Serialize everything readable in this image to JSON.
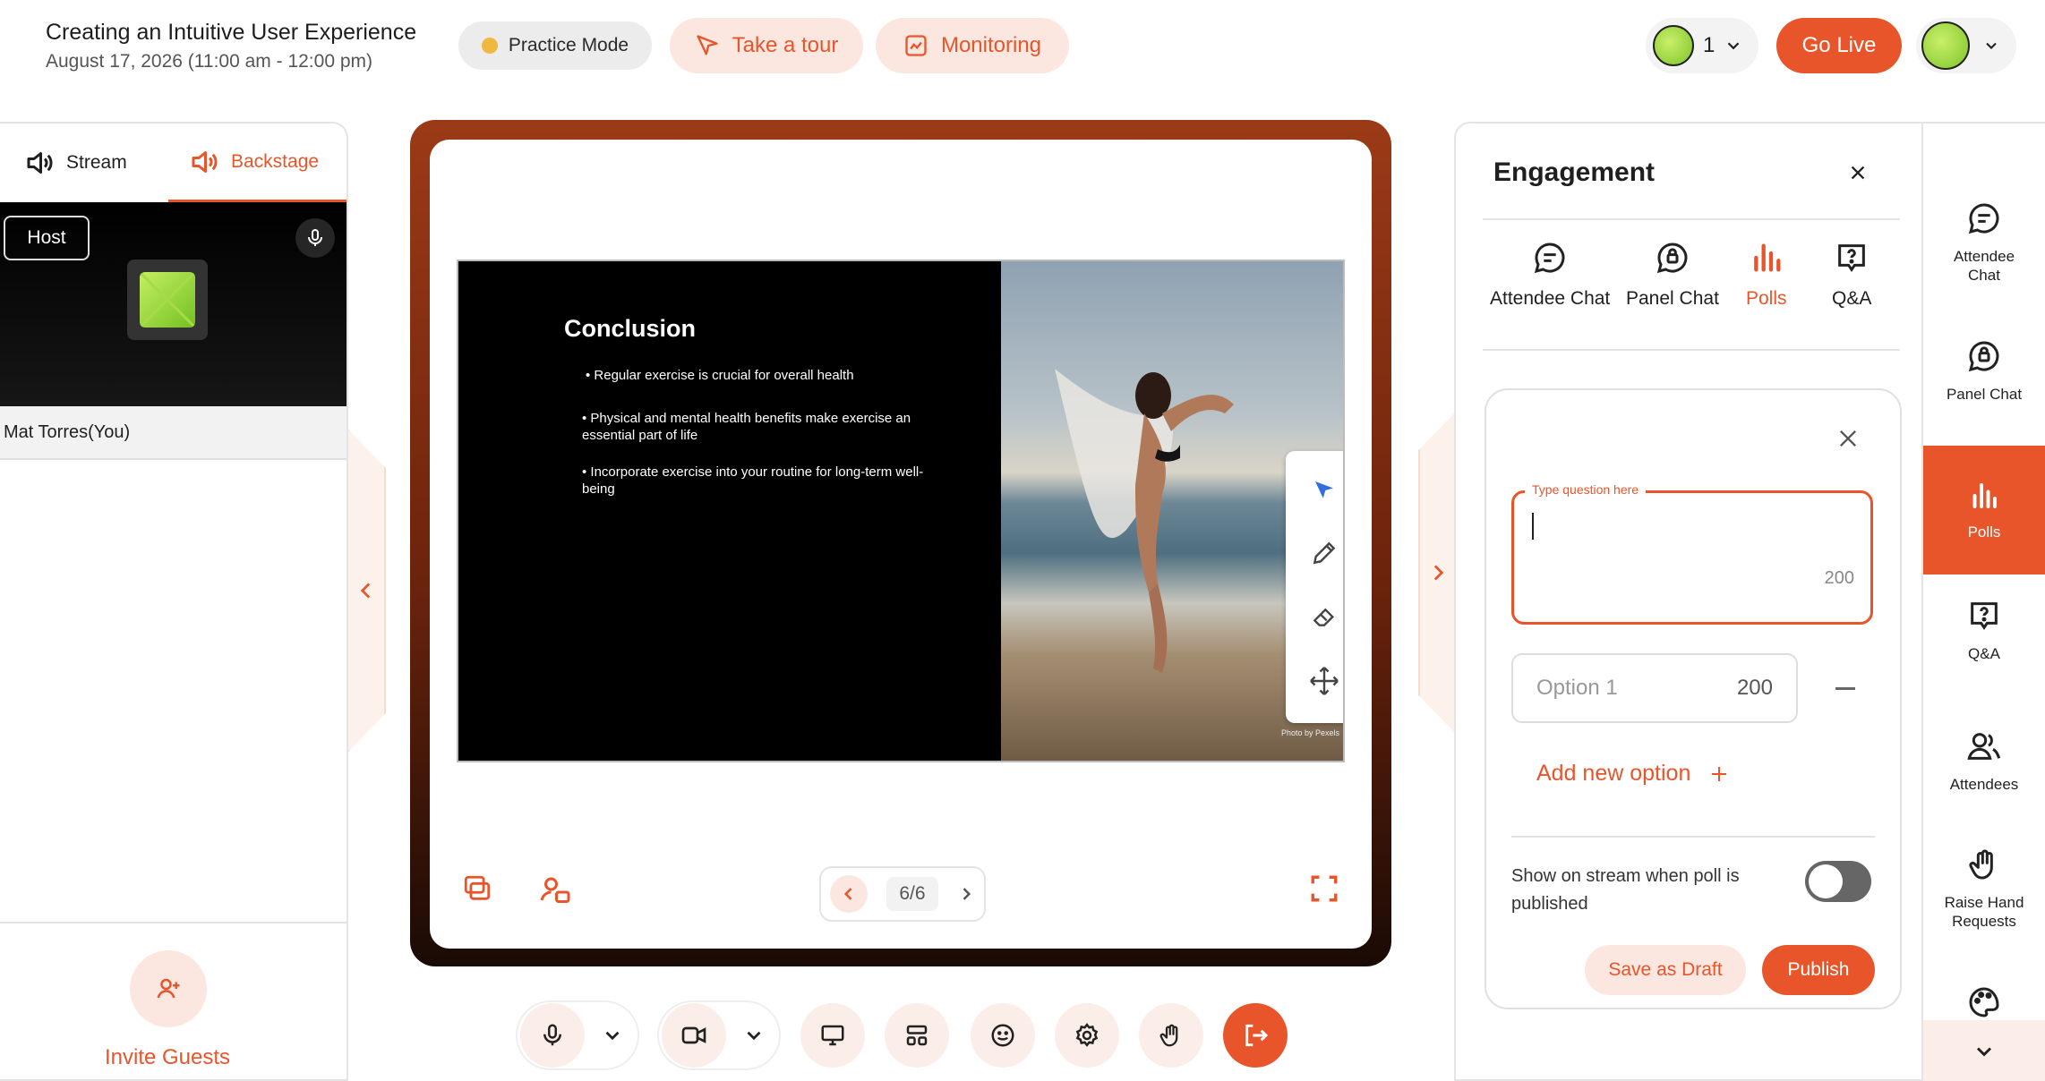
{
  "header": {
    "title": "Creating an Intuitive User Experience",
    "date": "August 17, 2026 (11:00 am - 12:00 pm)",
    "practice_mode": "Practice Mode",
    "take_tour": "Take a tour",
    "monitoring": "Monitoring",
    "attendee_count": "1",
    "go_live": "Go Live"
  },
  "left_panel": {
    "tabs": [
      {
        "label": "Stream",
        "icon": "speaker-icon"
      },
      {
        "label": "Backstage",
        "icon": "speaker-icon"
      }
    ],
    "active_tab": "Backstage",
    "host_badge": "Host",
    "host_name": "Mat Torres(You)",
    "invite_label": "Invite Guests"
  },
  "slide": {
    "title": "Conclusion",
    "bullets": [
      "• Regular exercise is crucial for overall health",
      "• Physical and mental health benefits make exercise an essential part of life",
      "• Incorporate exercise into your routine for long-term well-being"
    ],
    "photo_credit": "Photo by Pexels",
    "page": "6/6"
  },
  "engagement": {
    "title": "Engagement",
    "tabs": [
      {
        "label": "Attendee Chat",
        "icon": "chat-icon"
      },
      {
        "label": "Panel Chat",
        "icon": "panel-chat-icon"
      },
      {
        "label": "Polls",
        "icon": "polls-icon"
      },
      {
        "label": "Q&A",
        "icon": "qa-icon"
      }
    ],
    "active_tab": "Polls",
    "poll": {
      "question_label": "Type question here",
      "question_value": "",
      "question_counter": "200",
      "option_placeholder": "Option 1",
      "option_counter": "200",
      "add_option": "Add new option",
      "show_on_stream": "Show on stream when poll is published",
      "show_on_stream_enabled": false,
      "save_draft": "Save as Draft",
      "publish": "Publish"
    }
  },
  "rail": {
    "items": [
      {
        "label": "Attendee Chat",
        "icon": "chat-icon"
      },
      {
        "label": "Panel Chat",
        "icon": "panel-chat-icon"
      },
      {
        "label": "Polls",
        "icon": "polls-icon",
        "active": true
      },
      {
        "label": "Q&A",
        "icon": "qa-icon"
      },
      {
        "label": "Attendees",
        "icon": "attendees-icon"
      },
      {
        "label": "Raise Hand Requests",
        "icon": "raise-hand-icon"
      },
      {
        "label": "",
        "icon": "palette-icon"
      }
    ]
  },
  "colors": {
    "accent": "#e8552b",
    "accent_light": "#fbe7df",
    "stage_border": "#7b2a10"
  }
}
